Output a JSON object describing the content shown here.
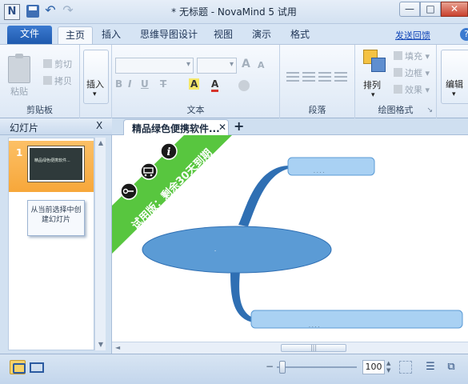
{
  "window": {
    "title": "* 无标题 - NovaMind 5 试用",
    "app_icon": "N",
    "controls": {
      "minimize": "—",
      "maximize": "□",
      "close": "✕"
    }
  },
  "quick_access": {
    "icons": [
      "save-icon",
      "undo-icon",
      "redo-icon"
    ]
  },
  "ribbon_tabs": [
    {
      "label": "文件",
      "active": false
    },
    {
      "label": "主页",
      "active": true
    },
    {
      "label": "插入",
      "active": false
    },
    {
      "label": "思维导图设计",
      "active": false
    },
    {
      "label": "视图",
      "active": false
    },
    {
      "label": "演示",
      "active": false
    },
    {
      "label": "格式",
      "active": false
    }
  ],
  "feedback_link": "发送回馈",
  "help_icon": "?",
  "ribbon": {
    "clipboard": {
      "label": "剪贴板",
      "paste": "粘贴",
      "cut": "剪切",
      "copy": "拷贝"
    },
    "insert": {
      "label": "插入"
    },
    "text": {
      "label": "文本",
      "bold": "B",
      "italic": "I",
      "underline": "U",
      "strike": "T",
      "font_color_glyph": "A",
      "highlight_glyph": "A",
      "grow": "A",
      "shrink": "A"
    },
    "paragraph": {
      "label": "段落"
    },
    "drawing": {
      "label": "绘图格式",
      "arrange": "排列",
      "fill": "填充",
      "border": "边框",
      "effect": "效果",
      "launcher": "↘"
    },
    "edit": {
      "label": "编辑"
    }
  },
  "slides_panel": {
    "title": "幻灯片",
    "close": "X",
    "slides": [
      {
        "number": "1",
        "thumb_text": "精品绿色便携软件..."
      }
    ],
    "new_slide_text": "从当前选择中创建幻灯片"
  },
  "doc_tab": {
    "label": "精品绿色便携软件...",
    "close": "✕",
    "add": "+"
  },
  "canvas": {
    "banner_text": "试用版：剩余30天到期",
    "banner_icons": [
      "info-icon",
      "cart-icon",
      "key-icon"
    ],
    "center_node_text": "-",
    "top_node_text": ". . . .",
    "bottom_node_text": ". . . ."
  },
  "status_bar": {
    "zoom": "100",
    "zoom_minus": "−"
  },
  "colors": {
    "node_fill": "#5b9bd5",
    "node_light_fill": "#a9d1f3",
    "branch": "#2f6fb3",
    "banner": "#58c63f",
    "slide_selected": "#f7a73a",
    "file_tab": "#2a66bd"
  }
}
